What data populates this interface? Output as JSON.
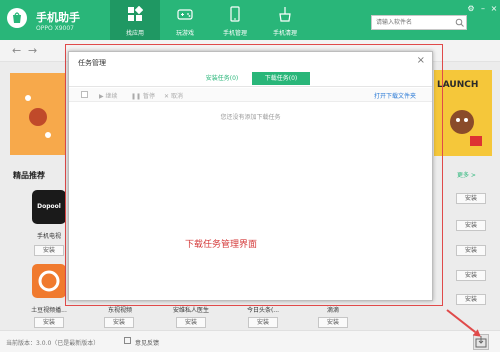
{
  "app": {
    "title": "手机助手",
    "subtitle": "OPPO X9007"
  },
  "nav": [
    {
      "label": "找应用",
      "icon": "grid-icon"
    },
    {
      "label": "玩游戏",
      "icon": "gamepad-icon"
    },
    {
      "label": "手机管理",
      "icon": "phone-icon"
    },
    {
      "label": "手机清理",
      "icon": "broom-icon"
    }
  ],
  "search": {
    "placeholder": "请输入软件名"
  },
  "window": {
    "settings": "⚙",
    "minimize": "–",
    "close": "×"
  },
  "dialog": {
    "title": "任务管理",
    "close": "×",
    "tabs": [
      {
        "label": "安装任务(0)"
      },
      {
        "label": "下载任务(0)"
      }
    ],
    "actions": [
      {
        "label": "继续"
      },
      {
        "label": "暂停"
      },
      {
        "label": "取消"
      }
    ],
    "open_folder": "打开下载文件夹",
    "empty_message": "您还没有添加下载任务"
  },
  "banner": {
    "right_text": "LAUNCH"
  },
  "section": {
    "title": "精品推荐",
    "more": "更多 >"
  },
  "apps": [
    {
      "name": "手机电视",
      "button": "安装",
      "icon_text": "Dopool",
      "color": "#1a1a1a"
    },
    {
      "name": "土豆视频播...",
      "button": "安装",
      "icon_text": "",
      "color": "#f07a2e"
    },
    {
      "name": "东视视频",
      "button": "安装",
      "icon_text": "",
      "color": "#e8e8e8"
    },
    {
      "name": "安维私人医生",
      "button": "安装",
      "icon_text": "",
      "color": "#e8e8e8"
    },
    {
      "name": "今日头条(...",
      "button": "安装",
      "icon_text": "",
      "color": "#e8e8e8"
    },
    {
      "name": "滴滴",
      "button": "安装",
      "icon_text": "",
      "color": "#e8e8e8"
    }
  ],
  "right_installs": [
    "安装",
    "安装",
    "安装",
    "安装",
    "安装"
  ],
  "annotation": "下载任务管理界面",
  "status": {
    "version": "当前版本：3.0.0（已是最新版本）",
    "feedback": "意见反馈"
  },
  "colors": {
    "brand": "#29b679",
    "annotation": "#d43a3a"
  }
}
